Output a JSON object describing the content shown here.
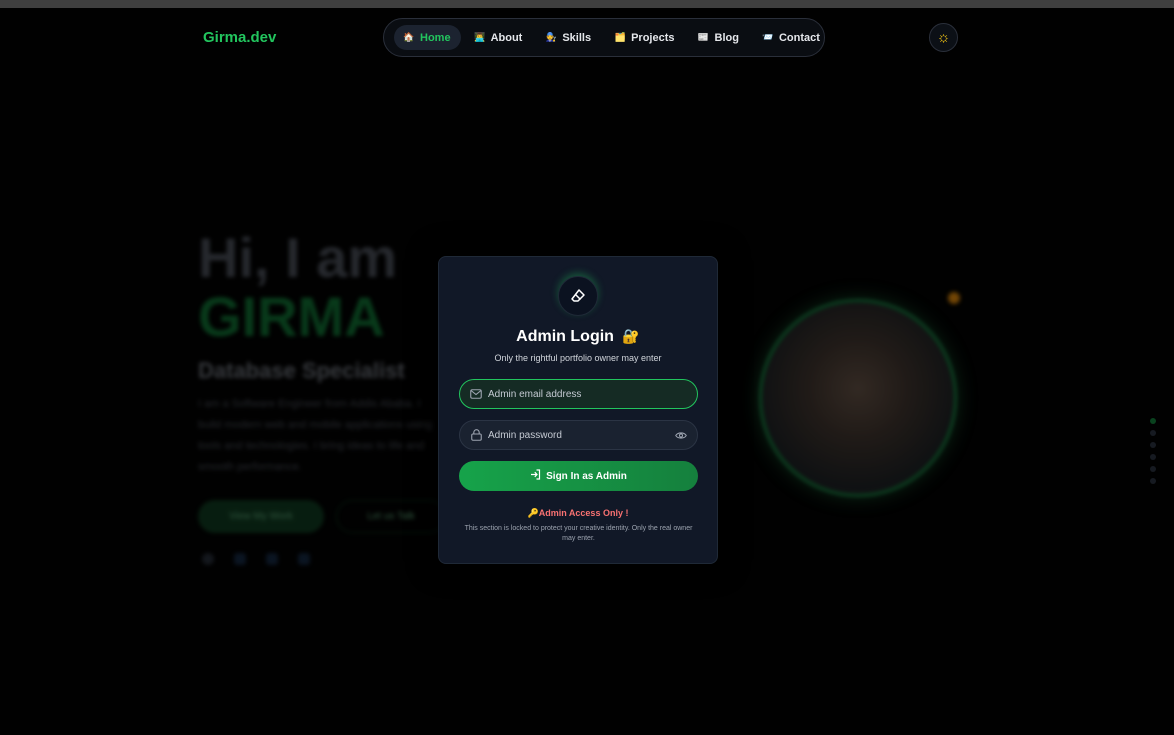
{
  "logo": "Girma.dev",
  "nav": {
    "items": [
      {
        "label": "Home",
        "icon": "🏠",
        "active": true
      },
      {
        "label": "About",
        "icon": "👨‍💻",
        "active": false
      },
      {
        "label": "Skills",
        "icon": "🧑‍🔧",
        "active": false
      },
      {
        "label": "Projects",
        "icon": "🗂️",
        "active": false
      },
      {
        "label": "Blog",
        "icon": "📰",
        "active": false
      },
      {
        "label": "Contact",
        "icon": "📨",
        "active": false
      }
    ],
    "theme_icon": "☼"
  },
  "hero": {
    "greeting": "Hi, I am",
    "name": "GIRMA",
    "role": "Database Specialist",
    "description": "I am a Software Engineer from Addis Ababa. I build modern web and mobile applications using tools and technologies. I bring ideas to life and smooth performance.",
    "primary_button": "View My Work",
    "secondary_button": "Let us Talk"
  },
  "modal": {
    "icon": "⌬",
    "title": "Admin Login",
    "title_emoji": "🔐",
    "subtitle": "Only the rightful portfolio owner may enter",
    "email_placeholder": "Admin email address",
    "password_placeholder": "Admin password",
    "signin_label": "Sign In as Admin",
    "warning": "🔑Admin Access Only !",
    "note": "This section is locked to protect your creative identity. Only the real owner may enter."
  },
  "colors": {
    "accent": "#22c55e",
    "modal_bg": "#111827",
    "warning": "#f87171",
    "theme_icon": "#facc15"
  }
}
